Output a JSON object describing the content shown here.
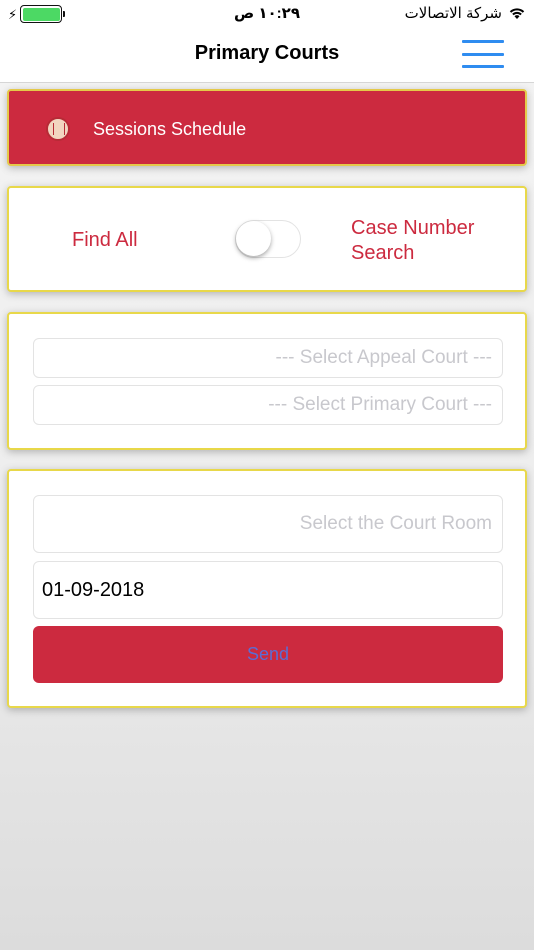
{
  "status_bar": {
    "time": "١٠:٢٩ ص",
    "carrier": "شركة الاتصالات",
    "battery_level": 1.0
  },
  "nav": {
    "title": "Primary Courts",
    "menu_icon": "hamburger-menu-icon"
  },
  "banner": {
    "label": "Sessions Schedule",
    "icon": "court-seal-icon"
  },
  "search_mode": {
    "left_label": "Find All",
    "right_label": "Case Number Search",
    "toggle_on": false
  },
  "court_selects": {
    "appeal_placeholder": "--- Select Appeal Court ---",
    "primary_placeholder": "--- Select Primary Court  ---"
  },
  "room_form": {
    "room_placeholder": "Select the Court Room",
    "date_value": "01-09-2018",
    "send_label": "Send"
  },
  "colors": {
    "accent_red": "#cc2a3f",
    "border_yellow": "#e8d84a",
    "menu_blue": "#2f8cf0"
  }
}
